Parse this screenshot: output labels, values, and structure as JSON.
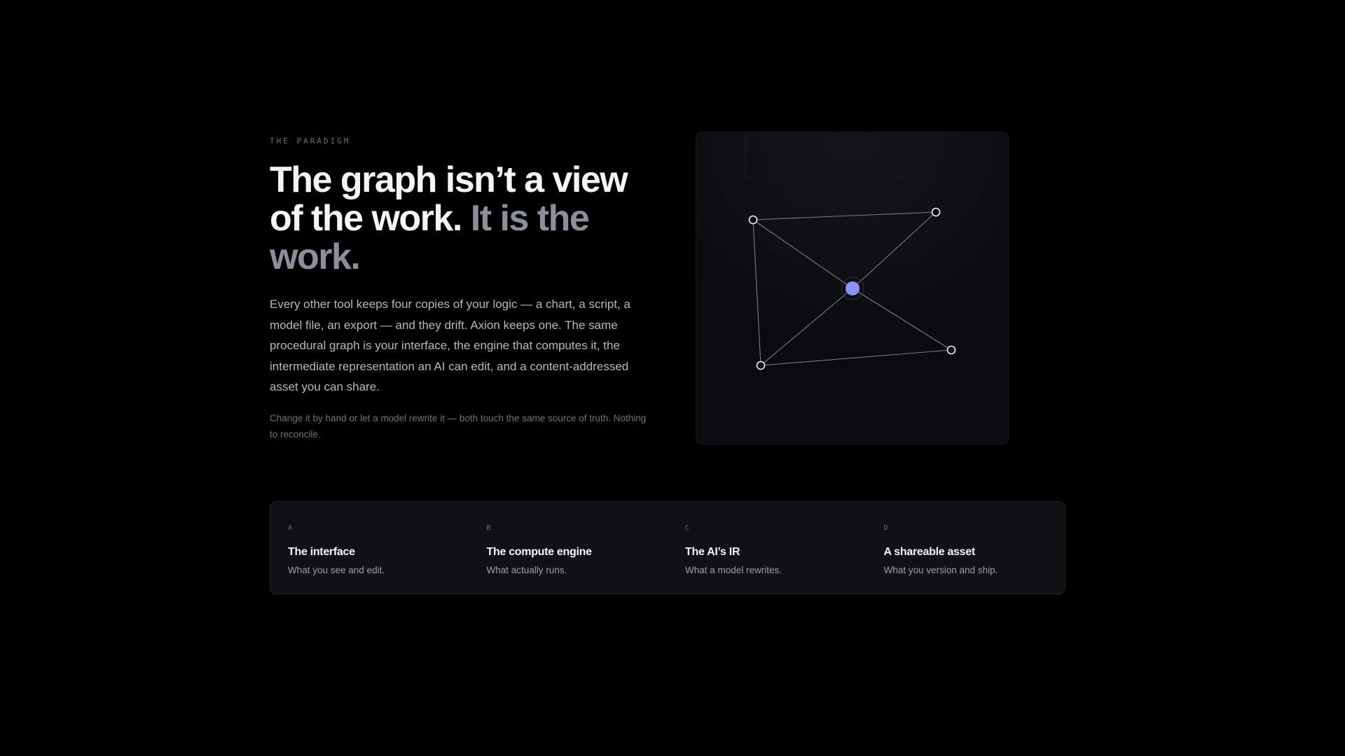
{
  "hero": {
    "eyebrow": "THE PARADIGM",
    "headline_main": "The graph isn’t a view of the work.",
    "headline_accent": "It is the work.",
    "lead": "Every other tool keeps four copies of your logic — a chart, a script, a model file, an export — and they drift. Axion keeps one. The same procedural graph is your interface, the engine that computes it, the intermediate representation an AI can edit, and a content-addressed asset you can share.",
    "aside": "Change it by hand or let a model rewrite it — both touch the same source of truth. Nothing to reconcile."
  },
  "graph": {
    "accent_color": "#8b93f8",
    "node_stroke": "#f2f3f5",
    "edge_color": "#7a7d86"
  },
  "cards": [
    {
      "letter": "A",
      "title": "The interface",
      "description": "What you see and edit."
    },
    {
      "letter": "B",
      "title": "The compute engine",
      "description": "What actually runs."
    },
    {
      "letter": "C",
      "title": "The AI’s IR",
      "description": "What a model rewrites."
    },
    {
      "letter": "D",
      "title": "A shareable asset",
      "description": "What you version and ship."
    }
  ]
}
